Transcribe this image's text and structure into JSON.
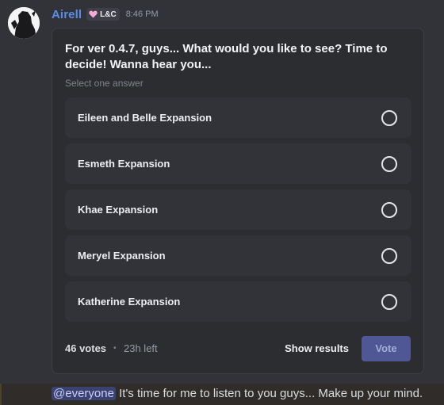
{
  "message": {
    "author": "Airell",
    "tag": {
      "icon": "pink-heart-icon",
      "label": "L&C",
      "color": "#f6a9d6"
    },
    "timestamp": "8:46 PM",
    "avatar": {
      "icon": "dark-silhouette-avatar"
    },
    "content": {
      "mention": "@everyone",
      "text": " It's time for me to listen to you guys... Make up your mind."
    }
  },
  "poll": {
    "question": "For ver 0.4.7, guys... What would you like to see? Time to decide! Wanna hear you...",
    "hint": "Select one answer",
    "answers": [
      {
        "label": "Eileen and Belle Expansion",
        "selected": false
      },
      {
        "label": "Esmeth Expansion",
        "selected": false
      },
      {
        "label": "Khae Expansion",
        "selected": false
      },
      {
        "label": "Meryel Expansion",
        "selected": false
      },
      {
        "label": "Katherine Expansion",
        "selected": false
      }
    ],
    "votes": "46 votes",
    "separator": "•",
    "time_left": "23h left",
    "show_results_label": "Show results",
    "vote_label": "Vote"
  },
  "colors": {
    "username": "#5a8ce8",
    "mention_bg": "#3c4270",
    "vote_button_disabled": "#4f5794",
    "poll_bg": "#2b2d31",
    "answer_bg": "#313338"
  }
}
